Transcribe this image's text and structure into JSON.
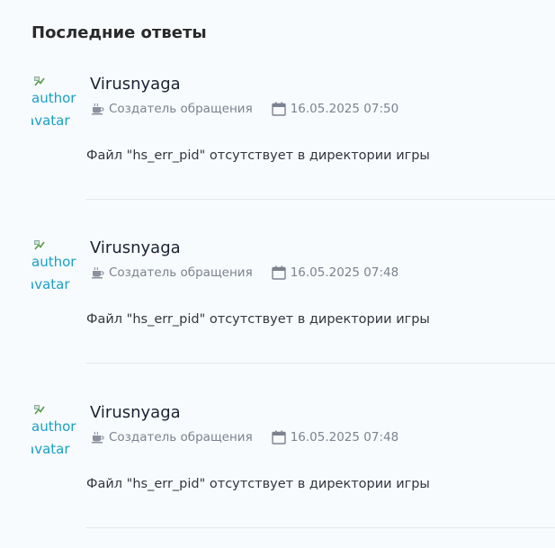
{
  "section": {
    "title": "Последние ответы"
  },
  "replies": [
    {
      "avatar_alt_line1": "author",
      "avatar_alt_line2": "avatar",
      "author": "Virusnyaga",
      "role": "Создатель обращения",
      "datetime": "16.05.2025 07:50",
      "text": "Файл \"hs_err_pid\" отсутствует в директории игры"
    },
    {
      "avatar_alt_line1": "author",
      "avatar_alt_line2": "avatar",
      "author": "Virusnyaga",
      "role": "Создатель обращения",
      "datetime": "16.05.2025 07:48",
      "text": "Файл \"hs_err_pid\" отсутствует в директории игры"
    },
    {
      "avatar_alt_line1": "author",
      "avatar_alt_line2": "avatar",
      "author": "Virusnyaga",
      "role": "Создатель обращения",
      "datetime": "16.05.2025 07:48",
      "text": "Файл \"hs_err_pid\" отсутствует в директории игры"
    }
  ],
  "icons": {
    "role": "coffee-cup-icon",
    "date": "calendar-icon",
    "avatar_placeholder": "broken-image-icon"
  },
  "colors": {
    "background": "#f8fbfd",
    "title": "#2a2a2a",
    "author": "#1a2333",
    "meta": "#7c8290",
    "text": "#333640",
    "alt_text": "#1aa0c6",
    "divider": "#e5e9ee"
  }
}
